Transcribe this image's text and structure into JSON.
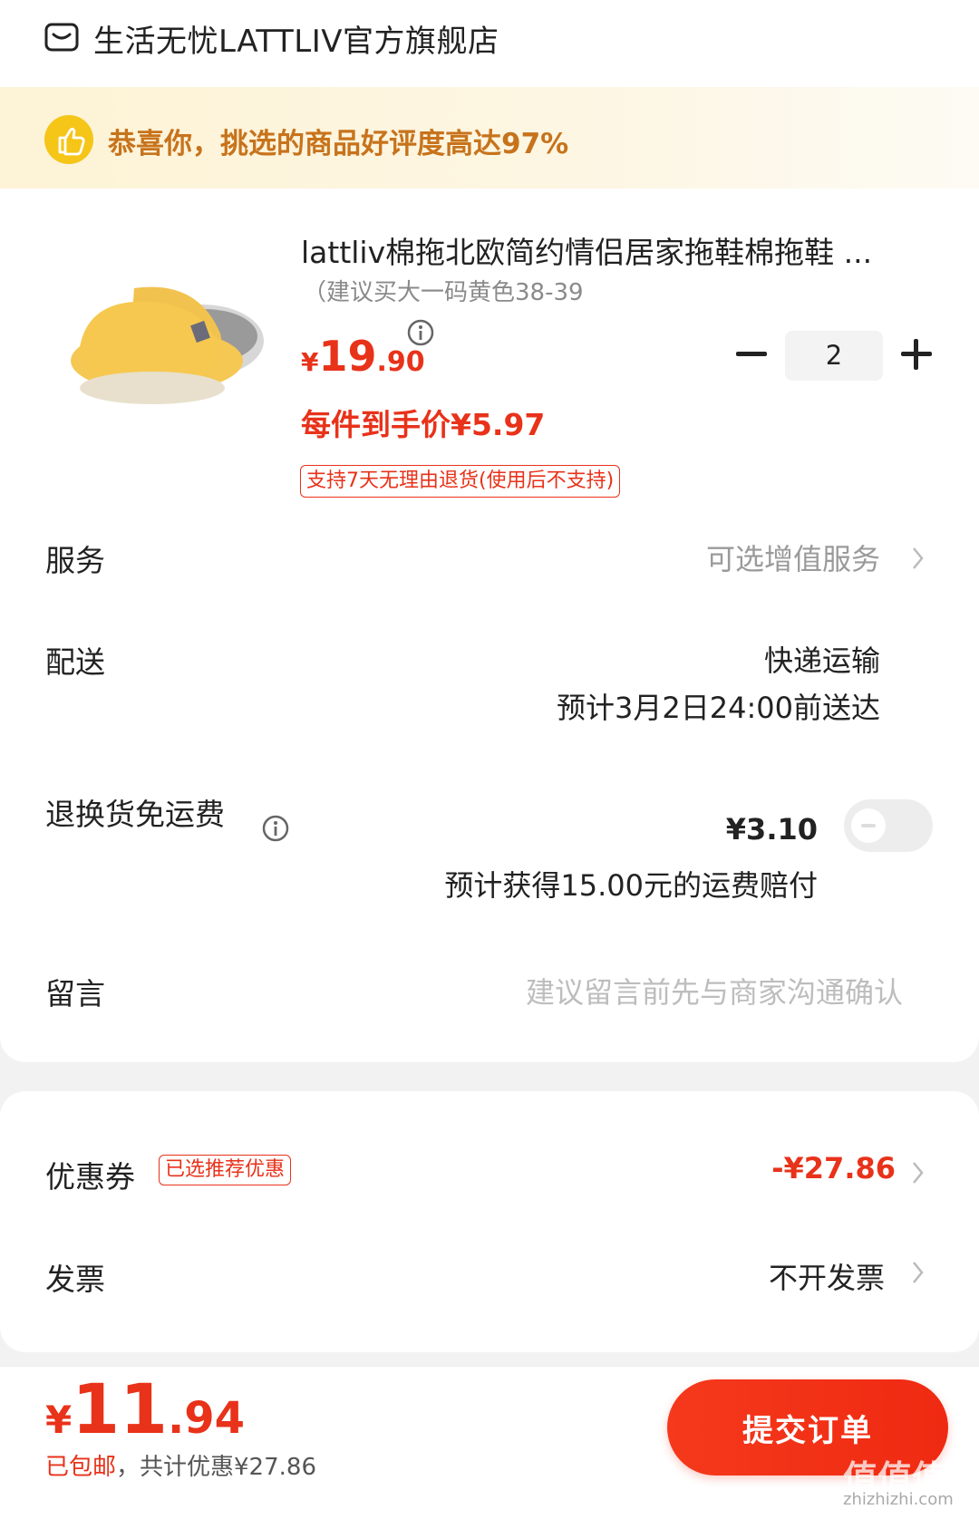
{
  "store": {
    "name": "生活无忧LATTLIV官方旗舰店",
    "icon": "store-icon"
  },
  "banner": {
    "text": "恭喜你，挑选的商品好评度高达97%",
    "icon": "thumbs-up-icon"
  },
  "product": {
    "title": "lattliv棉拖北欧简约情侣居家拖鞋棉拖鞋 ...",
    "spec": "（建议买大一码黄色38-39",
    "price_currency": "¥",
    "price_int": "19",
    "price_dec": ".90",
    "quantity": "2",
    "unit_price": "每件到手价¥5.97",
    "return_policy": "支持7天无理由退货(使用后不支持)"
  },
  "rows": {
    "service": {
      "label": "服务",
      "value": "可选增值服务"
    },
    "delivery": {
      "label": "配送",
      "value": "快递运输",
      "eta": "预计3月2日24:00前送达"
    },
    "return_shipping": {
      "label": "退换货免运费",
      "value": "¥3.10",
      "note": "预计获得15.00元的运费赔付",
      "toggle_on": false
    },
    "message": {
      "label": "留言",
      "placeholder": "建议留言前先与商家沟通确认"
    },
    "coupon": {
      "label": "优惠券",
      "tag": "已选推荐优惠",
      "value": "-¥27.86"
    },
    "invoice": {
      "label": "发票",
      "value": "不开发票"
    }
  },
  "footer": {
    "total_currency": "¥",
    "total_int": "11",
    "total_dec": ".94",
    "note_red": "已包邮",
    "note_gray": "，共计优惠¥27.86",
    "submit_label": "提交订单"
  },
  "watermark": {
    "main": "值值值",
    "sub": "zhizhizhi.com"
  },
  "colors": {
    "accent": "#e8321a",
    "banner_text": "#c7731c",
    "thumb": "#f5c518"
  }
}
